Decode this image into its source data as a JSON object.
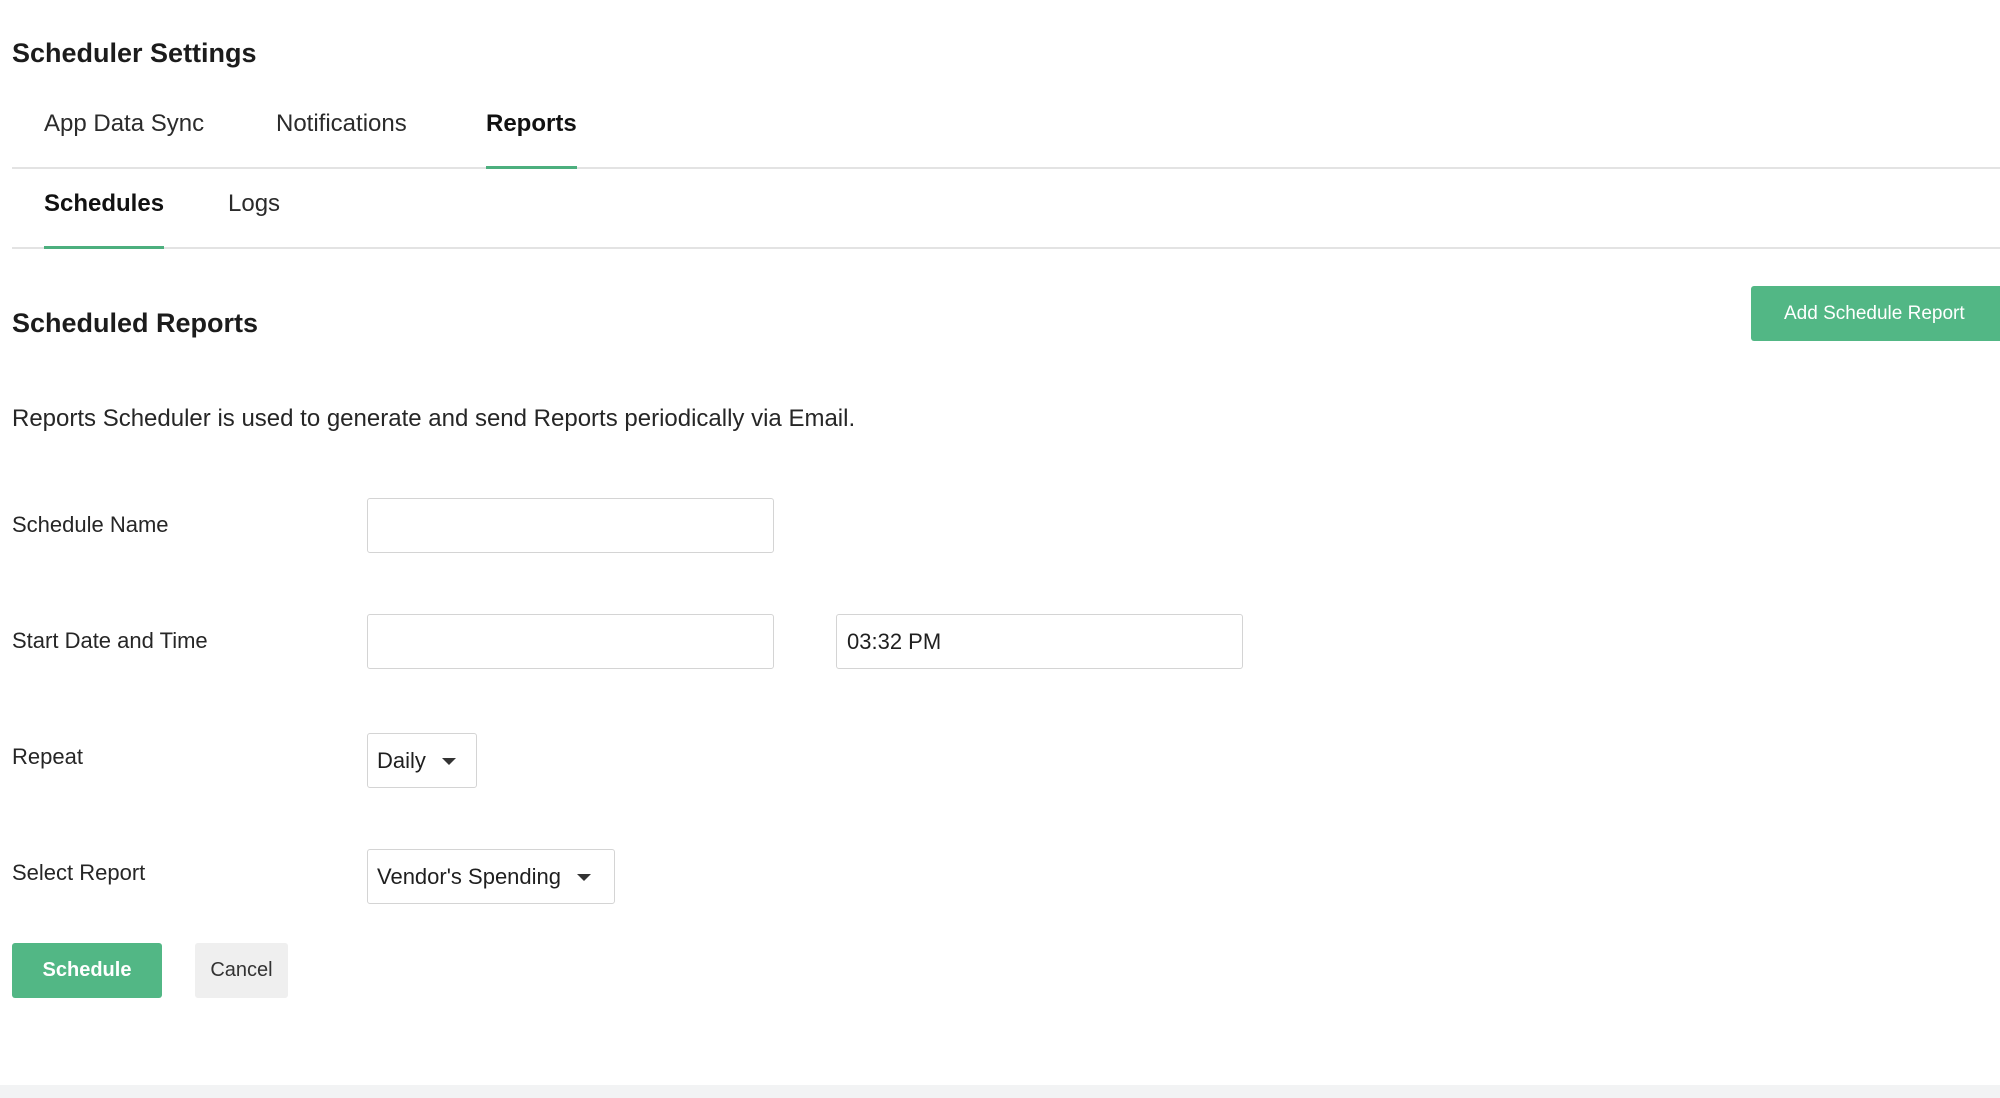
{
  "page": {
    "title": "Scheduler Settings"
  },
  "tabs_primary": [
    {
      "label": "App Data Sync",
      "active": false
    },
    {
      "label": "Notifications",
      "active": false
    },
    {
      "label": "Reports",
      "active": true
    }
  ],
  "tabs_secondary": [
    {
      "label": "Schedules",
      "active": true
    },
    {
      "label": "Logs",
      "active": false
    }
  ],
  "section": {
    "title": "Scheduled Reports",
    "add_button_label": "Add Schedule Report",
    "description": "Reports Scheduler is used to generate and send Reports periodically via Email."
  },
  "form": {
    "schedule_name": {
      "label": "Schedule Name",
      "value": ""
    },
    "start_date_time": {
      "label": "Start Date and Time",
      "date_value": "",
      "time_value": "03:32 PM"
    },
    "repeat": {
      "label": "Repeat",
      "selected": "Daily"
    },
    "select_report": {
      "label": "Select Report",
      "selected": "Vendor's Spending"
    }
  },
  "actions": {
    "schedule_label": "Schedule",
    "cancel_label": "Cancel"
  },
  "colors": {
    "accent": "#52b785",
    "tab_underline": "#4caf7e",
    "divider": "#e3e3e3"
  }
}
